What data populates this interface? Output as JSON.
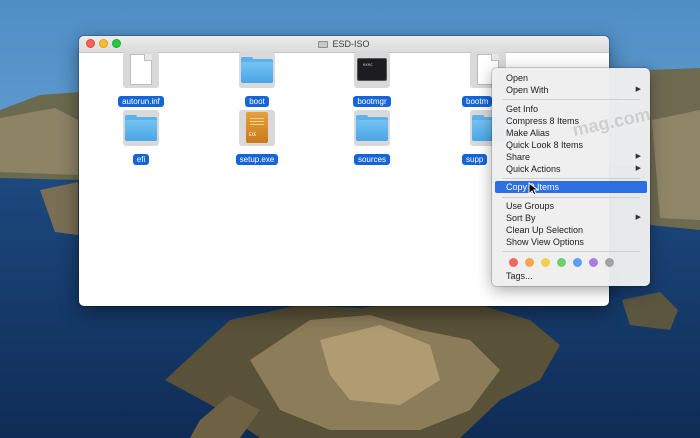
{
  "window": {
    "title": "ESD-ISO",
    "items": [
      {
        "label": "autorun.inf",
        "kind": "document"
      },
      {
        "label": "boot",
        "kind": "folder"
      },
      {
        "label": "bootmgr",
        "kind": "exec"
      },
      {
        "label": "bootm",
        "kind": "document"
      },
      {
        "label": "efi",
        "kind": "folder"
      },
      {
        "label": "setup.exe",
        "kind": "exe"
      },
      {
        "label": "sources",
        "kind": "folder"
      },
      {
        "label": "supp",
        "kind": "folder"
      }
    ],
    "exec_icon_text": "exec",
    "exe_icon_text": "EXE"
  },
  "context_menu": {
    "items": {
      "open": "Open",
      "open_with": "Open With",
      "get_info": "Get Info",
      "compress": "Compress 8 Items",
      "make_alias": "Make Alias",
      "quick_look": "Quick Look 8 Items",
      "share": "Share",
      "quick_actions": "Quick Actions",
      "copy": "Copy 8 Items",
      "use_groups": "Use Groups",
      "sort_by": "Sort By",
      "clean_up": "Clean Up Selection",
      "view_options": "Show View Options",
      "tags": "Tags..."
    },
    "submenu_arrow": "▶",
    "highlighted": "copy",
    "tag_colors": [
      "#f2665f",
      "#f6a54a",
      "#f3cf4c",
      "#6fce6a",
      "#5a9ff0",
      "#b07be0",
      "#a3a3a3"
    ]
  },
  "watermark": "mag.com"
}
